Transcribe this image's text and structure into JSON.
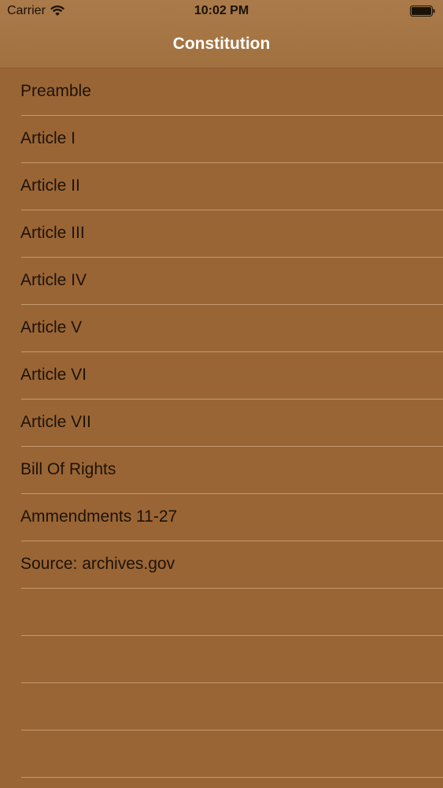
{
  "status_bar": {
    "carrier": "Carrier",
    "time": "10:02 PM",
    "wifi_icon": "wifi-icon",
    "battery_icon": "battery-icon"
  },
  "nav": {
    "title": "Constitution"
  },
  "list": {
    "items": [
      {
        "label": "Preamble"
      },
      {
        "label": "Article I"
      },
      {
        "label": "Article II"
      },
      {
        "label": "Article III"
      },
      {
        "label": "Article IV"
      },
      {
        "label": "Article V"
      },
      {
        "label": "Article VI"
      },
      {
        "label": "Article VII"
      },
      {
        "label": "Bill Of Rights"
      },
      {
        "label": "Ammendments 11-27"
      },
      {
        "label": "Source: archives.gov"
      }
    ],
    "empty_rows": 4
  },
  "colors": {
    "background": "#9a6535",
    "nav_bar": "#a5743f",
    "separator": "#c39a6e",
    "title_text": "#ffffff",
    "row_text": "#1d1308"
  }
}
